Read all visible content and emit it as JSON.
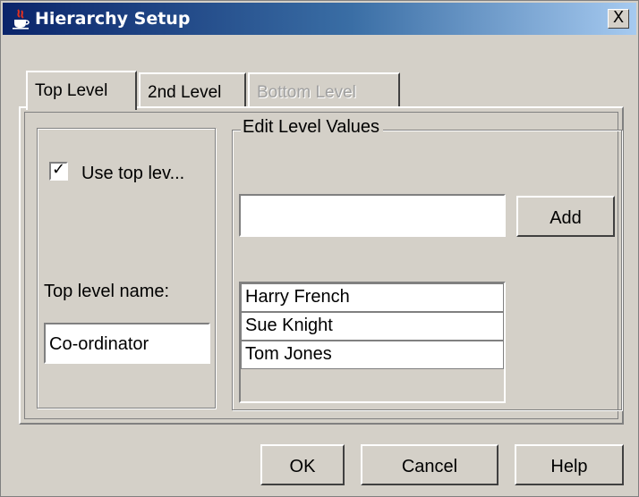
{
  "window": {
    "title": "Hierarchy Setup",
    "close_label": "X"
  },
  "tabs": [
    {
      "label": "Top Level",
      "state": "active"
    },
    {
      "label": "2nd Level",
      "state": "normal"
    },
    {
      "label": "Bottom Level",
      "state": "disabled"
    }
  ],
  "top_level": {
    "use_checkbox_label": "Use top lev...",
    "use_checked": true,
    "name_label": "Top level name:",
    "name_value": "Co-ordinator"
  },
  "edit_values": {
    "group_label": "Edit Level Values",
    "new_value": "",
    "add_label": "Add",
    "items": [
      "Harry French",
      "Sue Knight",
      "Tom Jones"
    ]
  },
  "footer": {
    "ok_label": "OK",
    "cancel_label": "Cancel",
    "help_label": "Help"
  }
}
